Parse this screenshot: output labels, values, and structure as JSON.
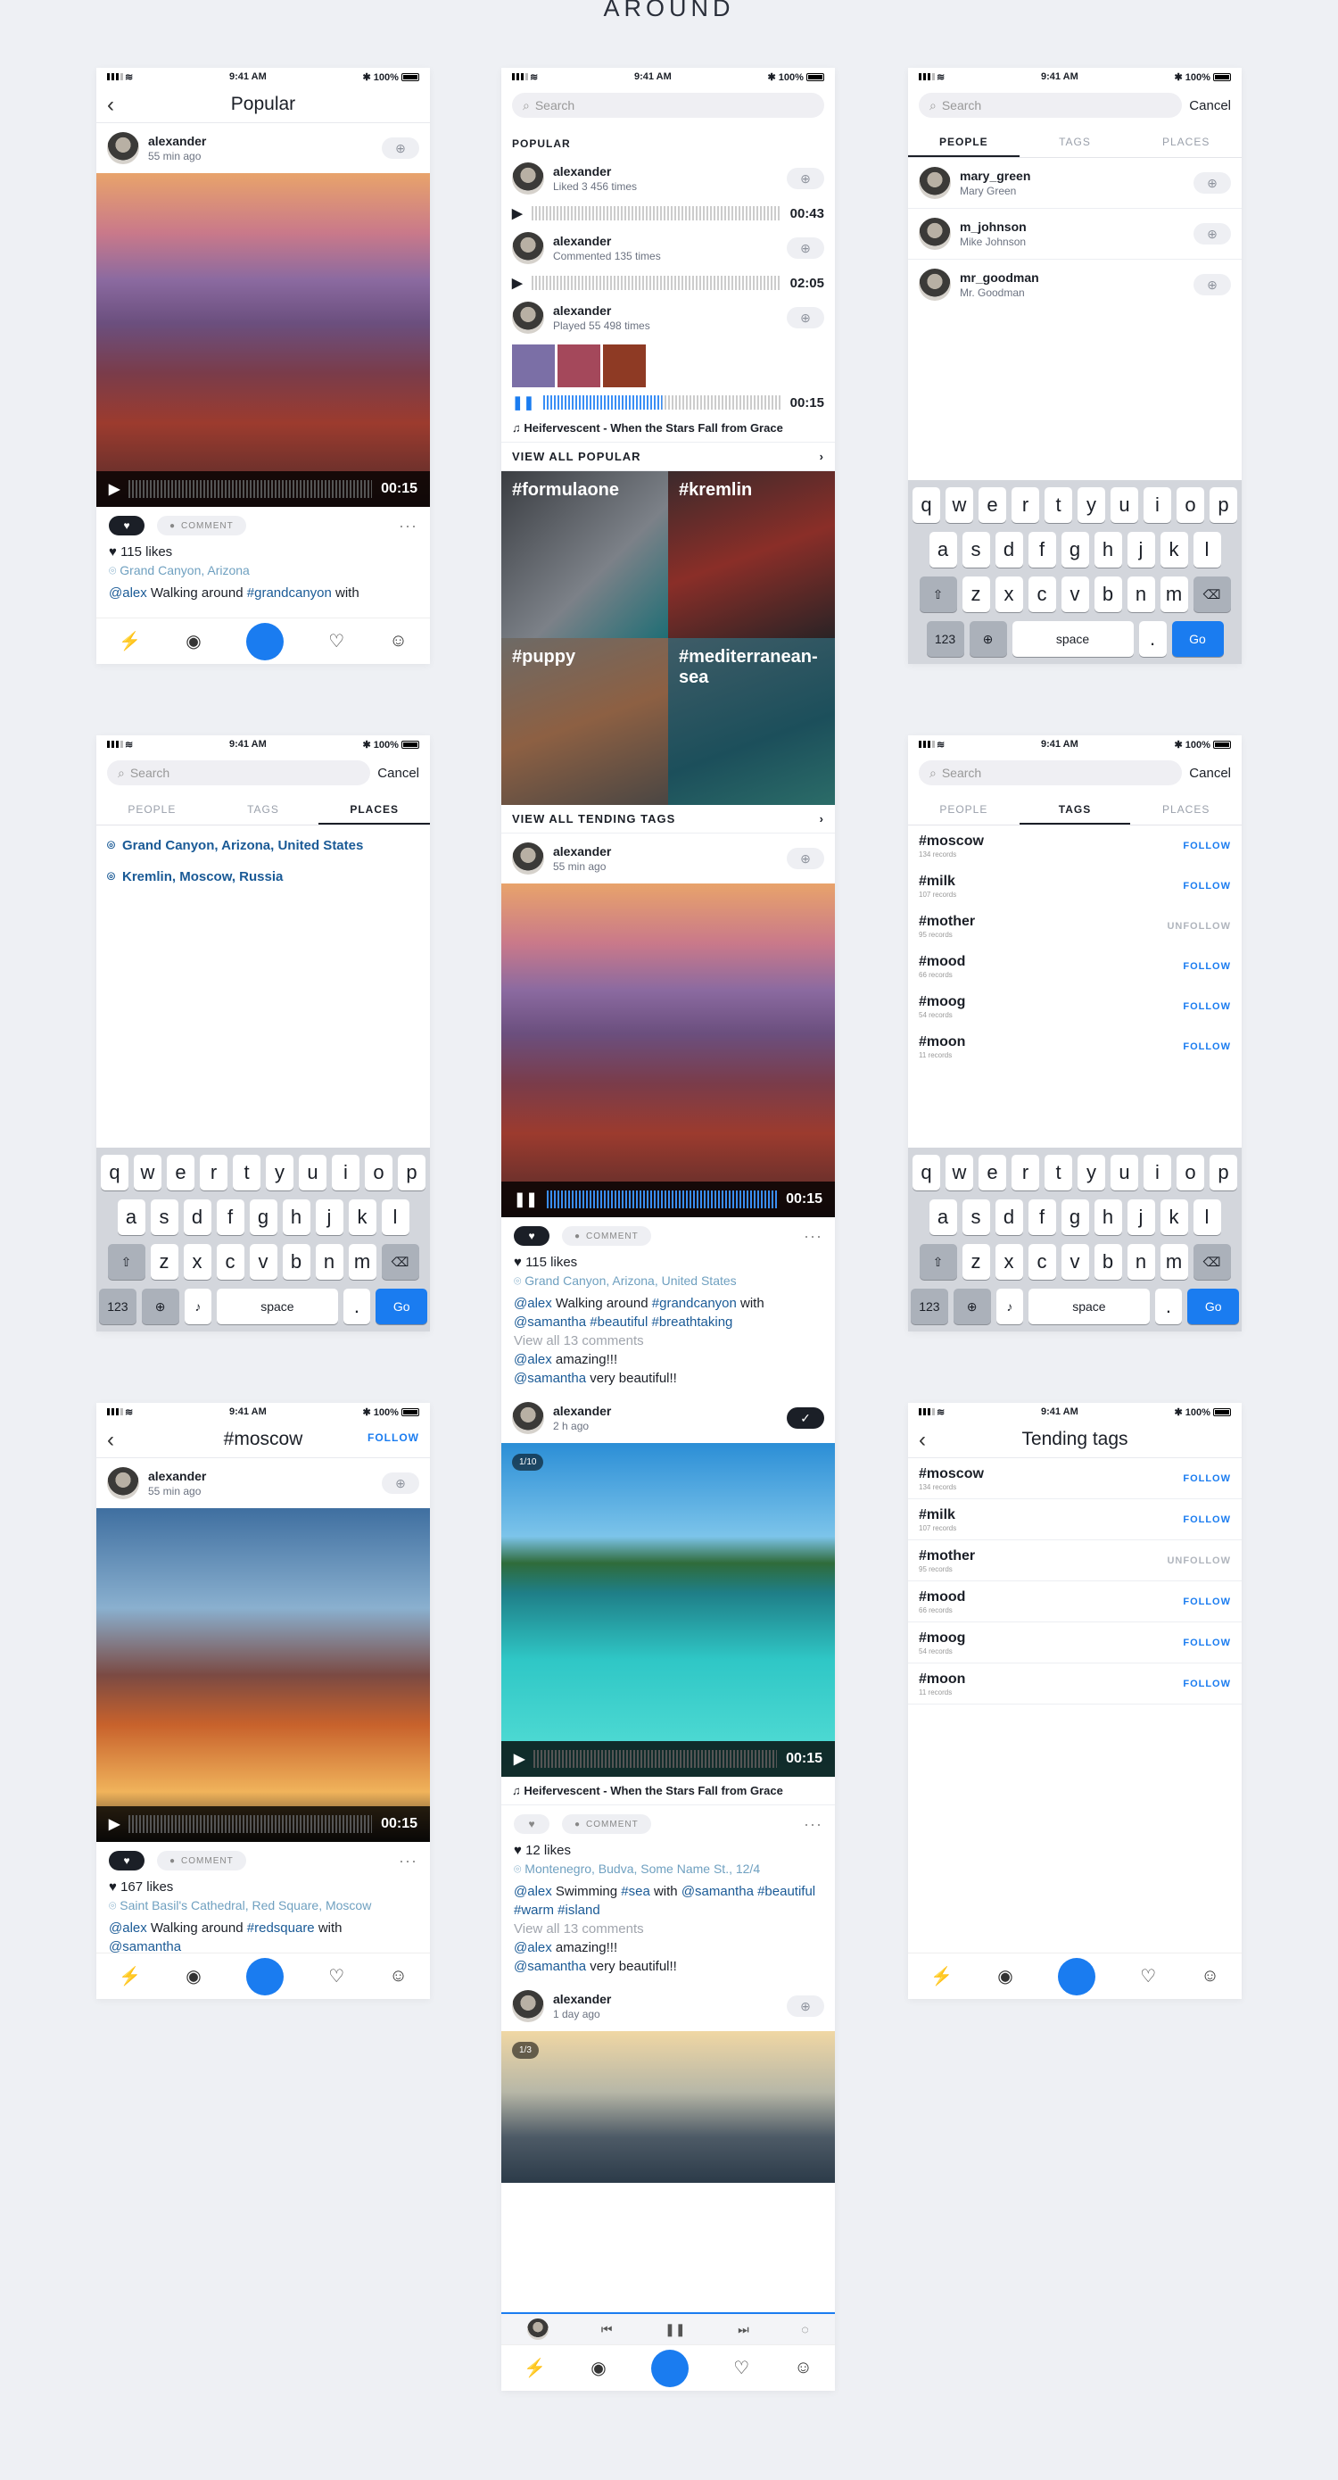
{
  "heading": "AROUND",
  "status": {
    "time": "9:41 AM",
    "battery": "100%"
  },
  "popular": {
    "title": "Popular",
    "user": "alexander",
    "time": "55 min ago",
    "duration": "00:15",
    "comment": "COMMENT",
    "likes": "115 likes",
    "place": "Grand Canyon, Arizona",
    "caption_user": "@alex",
    "caption_text": " Walking around ",
    "caption_tag": "#grandcanyon",
    "caption_end": " with"
  },
  "search": {
    "placeholder": "Search",
    "cancel": "Cancel"
  },
  "feed": {
    "section": "POPULAR",
    "items": [
      {
        "user": "alexander",
        "sub": "Liked 3 456 times",
        "dur": "00:43"
      },
      {
        "user": "alexander",
        "sub": "Commented 135 times",
        "dur": "02:05"
      },
      {
        "user": "alexander",
        "sub": "Played 55 498 times",
        "dur": "00:15"
      }
    ],
    "song": "Heifervescent - When the Stars Fall from Grace",
    "view_popular": "VIEW ALL POPULAR",
    "tags": [
      "#formulaone",
      "#kremlin",
      "#puppy",
      "#mediterranean-sea"
    ],
    "view_tags": "VIEW ALL TENDING TAGS",
    "post1": {
      "user": "alexander",
      "time": "55 min ago",
      "dur": "00:15",
      "comment": "COMMENT",
      "likes": "115 likes",
      "place": "Grand Canyon, Arizona, United States",
      "c1": "@alex",
      "c2": " Walking around ",
      "c3": "#grandcanyon",
      "c4": " with",
      "c5": "@samantha #beautiful #breathtaking",
      "viewall": "View all 13 comments",
      "r1u": "@alex",
      "r1": " amazing!!!",
      "r2u": "@samantha",
      "r2": " very beautiful!!"
    },
    "post2": {
      "user": "alexander",
      "time": "2 h ago",
      "badge": "1/10",
      "dur": "00:15",
      "song": "Heifervescent - When the Stars Fall from Grace",
      "comment": "COMMENT",
      "likes": "12 likes",
      "place": "Montenegro, Budva, Some Name St., 12/4",
      "c1": "@alex",
      "c2": " Swimming ",
      "c3": "#sea",
      "c4": " with ",
      "c5": "@samantha #beautiful",
      "c6": "#warm #island",
      "viewall": "View all 13 comments",
      "r1u": "@alex",
      "r1": " amazing!!!",
      "r2u": "@samantha",
      "r2": " very beautiful!!"
    },
    "post3": {
      "user": "alexander",
      "time": "1 day ago",
      "badge": "1/3"
    }
  },
  "people": {
    "tabs": [
      "PEOPLE",
      "TAGS",
      "PLACES"
    ],
    "users": [
      {
        "name": "mary_green",
        "sub": "Mary Green"
      },
      {
        "name": "m_johnson",
        "sub": "Mike Johnson"
      },
      {
        "name": "mr_goodman",
        "sub": "Mr. Goodman"
      }
    ]
  },
  "places": [
    "Grand Canyon, Arizona, United States",
    "Kremlin, Moscow, Russia"
  ],
  "tags": [
    {
      "name": "#moscow",
      "rec": "134 records",
      "act": "FOLLOW"
    },
    {
      "name": "#milk",
      "rec": "107 records",
      "act": "FOLLOW"
    },
    {
      "name": "#mother",
      "rec": "95 records",
      "act": "UNFOLLOW"
    },
    {
      "name": "#mood",
      "rec": "66 records",
      "act": "FOLLOW"
    },
    {
      "name": "#moog",
      "rec": "54 records",
      "act": "FOLLOW"
    },
    {
      "name": "#moon",
      "rec": "11 records",
      "act": "FOLLOW"
    }
  ],
  "moscow": {
    "title": "#moscow",
    "follow": "FOLLOW",
    "user": "alexander",
    "time": "55 min ago",
    "dur": "00:15",
    "comment": "COMMENT",
    "likes": "167 likes",
    "place": "Saint Basil's Cathedral, Red Square, Moscow",
    "c1": "@alex",
    "c2": " Walking around ",
    "c3": "#redsquare",
    "c4": " with ",
    "c5": "@samantha"
  },
  "tending": {
    "title": "Tending tags"
  },
  "keyboard": {
    "row1": [
      "q",
      "w",
      "e",
      "r",
      "t",
      "y",
      "u",
      "i",
      "o",
      "p"
    ],
    "row2": [
      "a",
      "s",
      "d",
      "f",
      "g",
      "h",
      "j",
      "k",
      "l"
    ],
    "row3": [
      "z",
      "x",
      "c",
      "v",
      "b",
      "n",
      "m"
    ],
    "num": "123",
    "space": "space",
    "dot": ".",
    "go": "Go"
  }
}
